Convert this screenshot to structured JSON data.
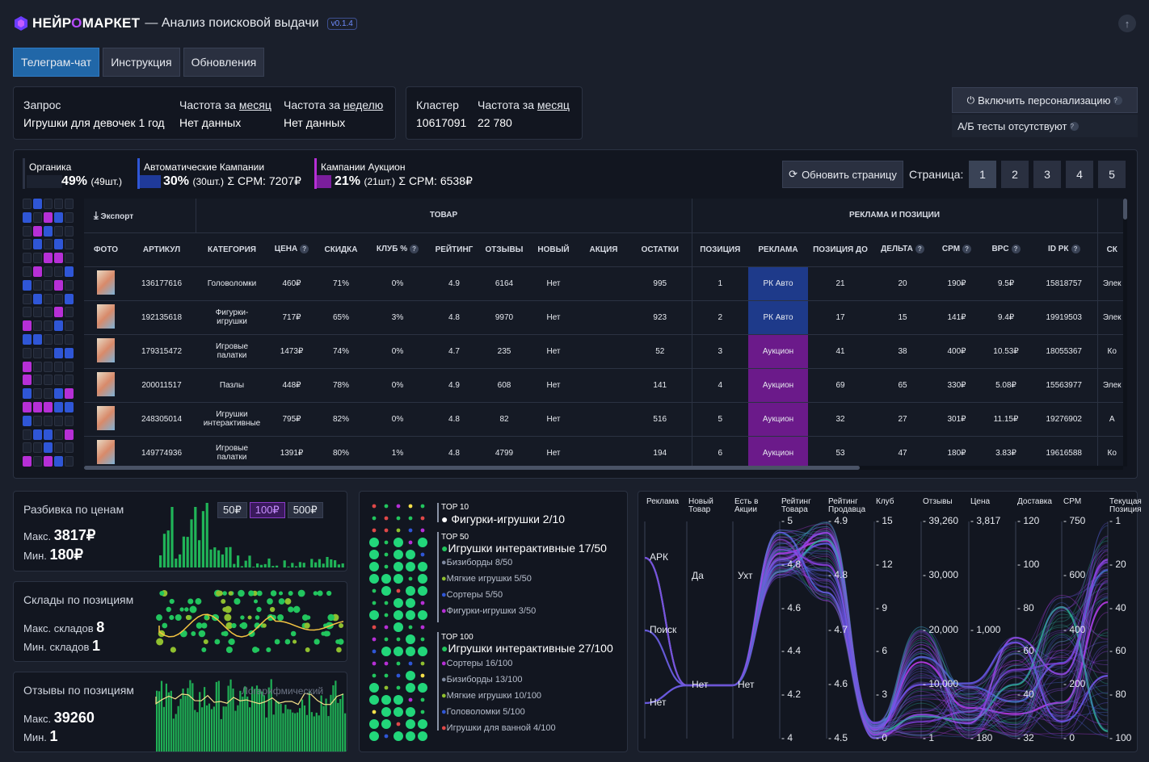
{
  "header": {
    "brand_a": "НЕЙР",
    "brand_o": "О",
    "brand_b": "МАРКЕТ",
    "title": "— Анализ поисковой выдачи",
    "version": "v0.1.4"
  },
  "tabs": [
    {
      "label": "Телеграм-чат"
    },
    {
      "label": "Инструкция"
    },
    {
      "label": "Обновления"
    }
  ],
  "query": {
    "label": "Запрос",
    "value": "Игрушки для девочек 1 год",
    "freq_month_label_a": "Частота за ",
    "freq_month_label_b": "месяц",
    "freq_month_value": "Нет данных",
    "freq_week_label_a": "Частота за ",
    "freq_week_label_b": "неделю",
    "freq_week_value": "Нет данных"
  },
  "cluster": {
    "label": "Кластер",
    "value": "10617091",
    "freq_label_a": "Частота за ",
    "freq_label_b": "месяц",
    "freq_value": "22 780"
  },
  "personalize": {
    "button": "Включить персонализацию",
    "ab": "А/Б тесты отсутствуют"
  },
  "stats": {
    "organic": {
      "name": "Органика",
      "pct": "49%",
      "count": "(49шт.)",
      "color": "#2c3345"
    },
    "auto": {
      "name": "Автоматические Кампании",
      "pct": "30%",
      "count": "(30шт.)",
      "cpm": "Σ CPM: 7207₽",
      "color": "#2f56d6"
    },
    "auction": {
      "name": "Кампании Аукцион",
      "pct": "21%",
      "count": "(21шт.)",
      "cpm": "Σ CPM: 6538₽",
      "color": "#b62fd6"
    }
  },
  "refresh": "Обновить страницу",
  "pagination": {
    "label": "Страница:",
    "pages": [
      "1",
      "2",
      "3",
      "4",
      "5"
    ],
    "active": "1"
  },
  "table": {
    "export": "Экспорт",
    "group_product": "ТОВАР",
    "group_ads": "РЕКЛАМА И ПОЗИЦИИ",
    "columns": [
      "ФОТО",
      "АРТИКУЛ",
      "КАТЕГОРИЯ",
      "ЦЕНА",
      "СКИДКА",
      "КЛУБ %",
      "РЕЙТИНГ",
      "ОТЗЫВЫ",
      "НОВЫЙ",
      "АКЦИЯ",
      "ОСТАТКИ",
      "ПОЗИЦИЯ",
      "РЕКЛАМА",
      "ПОЗИЦИЯ ДО",
      "ДЕЛЬТА",
      "CPM",
      "BPC",
      "ID РК",
      "СК"
    ],
    "rows": [
      {
        "sku": "136177616",
        "cat": "Головоломки",
        "price": "460₽",
        "disc": "71%",
        "club": "0%",
        "rating": "4.9",
        "reviews": "6164",
        "new": "Нет",
        "promo": "",
        "stock": "995",
        "pos": "1",
        "ad": "РК Авто",
        "pos_before": "21",
        "delta": "20",
        "cpm": "190₽",
        "bpc": "9.5₽",
        "id_rk": "15818757",
        "sk": "Элек"
      },
      {
        "sku": "192135618",
        "cat": "Фигурки-игрушки",
        "price": "717₽",
        "disc": "65%",
        "club": "3%",
        "rating": "4.8",
        "reviews": "9970",
        "new": "Нет",
        "promo": "",
        "stock": "923",
        "pos": "2",
        "ad": "РК Авто",
        "pos_before": "17",
        "delta": "15",
        "cpm": "141₽",
        "bpc": "9.4₽",
        "id_rk": "19919503",
        "sk": "Элек"
      },
      {
        "sku": "179315472",
        "cat": "Игровые палатки",
        "price": "1473₽",
        "disc": "74%",
        "club": "0%",
        "rating": "4.7",
        "reviews": "235",
        "new": "Нет",
        "promo": "",
        "stock": "52",
        "pos": "3",
        "ad": "Аукцион",
        "pos_before": "41",
        "delta": "38",
        "cpm": "400₽",
        "bpc": "10.53₽",
        "id_rk": "18055367",
        "sk": "Ко"
      },
      {
        "sku": "200011517",
        "cat": "Пазлы",
        "price": "448₽",
        "disc": "78%",
        "club": "0%",
        "rating": "4.9",
        "reviews": "608",
        "new": "Нет",
        "promo": "",
        "stock": "141",
        "pos": "4",
        "ad": "Аукцион",
        "pos_before": "69",
        "delta": "65",
        "cpm": "330₽",
        "bpc": "5.08₽",
        "id_rk": "15563977",
        "sk": "Элек"
      },
      {
        "sku": "248305014",
        "cat": "Игрушки интерактивные",
        "price": "795₽",
        "disc": "82%",
        "club": "0%",
        "rating": "4.8",
        "reviews": "82",
        "new": "Нет",
        "promo": "",
        "stock": "516",
        "pos": "5",
        "ad": "Аукцион",
        "pos_before": "32",
        "delta": "27",
        "cpm": "301₽",
        "bpc": "11.15₽",
        "id_rk": "19276902",
        "sk": "А"
      },
      {
        "sku": "149774936",
        "cat": "Игровые палатки",
        "price": "1391₽",
        "disc": "80%",
        "club": "1%",
        "rating": "4.8",
        "reviews": "4799",
        "new": "Нет",
        "promo": "",
        "stock": "194",
        "pos": "6",
        "ad": "Аукцион",
        "pos_before": "53",
        "delta": "47",
        "cpm": "180₽",
        "bpc": "3.83₽",
        "id_rk": "19616588",
        "sk": "Ко"
      }
    ]
  },
  "price_panel": {
    "title": "Разбивка по ценам",
    "max_label": "Макс.",
    "max": "3817₽",
    "min_label": "Мин.",
    "min": "180₽",
    "buttons": [
      "50₽",
      "100₽",
      "500₽"
    ],
    "active": "100₽"
  },
  "stores_panel": {
    "title": "Склады по позициям",
    "max_label": "Макс. складов",
    "max": "8",
    "min_label": "Мин. складов",
    "min": "1"
  },
  "reviews_panel": {
    "title": "Отзывы по позициям",
    "max_label": "Макс.",
    "max": "39260",
    "min_label": "Мин.",
    "min": "1",
    "overlay": "Логарифмический"
  },
  "categories": {
    "top10": {
      "label": "TOP 10",
      "main": "Фигурки-игрушки",
      "main_count": "2/10"
    },
    "top50": {
      "label": "TOP 50",
      "main": "Игрушки интерактивные",
      "main_count": "17/50",
      "items": [
        "Бизиборды 8/50",
        "Мягкие игрушки 5/50",
        "Сортеры 5/50",
        "Фигурки-игрушки 3/50"
      ]
    },
    "top100": {
      "label": "TOP 100",
      "main": "Игрушки интерактивные",
      "main_count": "27/100",
      "items": [
        "Сортеры 16/100",
        "Бизиборды 13/100",
        "Мягкие игрушки 10/100",
        "Головоломки 5/100",
        "Игрушки для ванной 4/100"
      ]
    }
  },
  "parallel": {
    "axes": [
      {
        "name": "Реклама",
        "ticks": [
          "АРК",
          "Поиск",
          "Нет"
        ]
      },
      {
        "name": "Новый Товар",
        "ticks": [
          "Да",
          "Нет"
        ]
      },
      {
        "name": "Есть в Акции",
        "ticks": [
          "Ухт",
          "Нет"
        ]
      },
      {
        "name": "Рейтинг Товара",
        "ticks": [
          "5",
          "4.8",
          "4.6",
          "4.4",
          "4.2",
          "4"
        ]
      },
      {
        "name": "Рейтинг Продавца",
        "ticks": [
          "4.9",
          "4.8",
          "4.7",
          "4.6",
          "4.5"
        ]
      },
      {
        "name": "Клуб",
        "ticks": [
          "15",
          "12",
          "9",
          "6",
          "3",
          "0"
        ]
      },
      {
        "name": "Отзывы",
        "ticks": [
          "39,260",
          "30,000",
          "20,000",
          "10,000",
          "1"
        ]
      },
      {
        "name": "Цена",
        "ticks": [
          "3,817",
          "1,000",
          "180"
        ]
      },
      {
        "name": "Доставка",
        "ticks": [
          "120",
          "100",
          "80",
          "60",
          "40",
          "32"
        ]
      },
      {
        "name": "CPM",
        "ticks": [
          "750",
          "600",
          "400",
          "200",
          "0"
        ]
      },
      {
        "name": "Текущая Позиция",
        "ticks": [
          "1",
          "20",
          "40",
          "60",
          "80",
          "100"
        ]
      }
    ]
  },
  "colors": {
    "accent": "#2167a8",
    "purple": "#b62fd6",
    "blue": "#2f56d6",
    "green": "#22c55e"
  }
}
